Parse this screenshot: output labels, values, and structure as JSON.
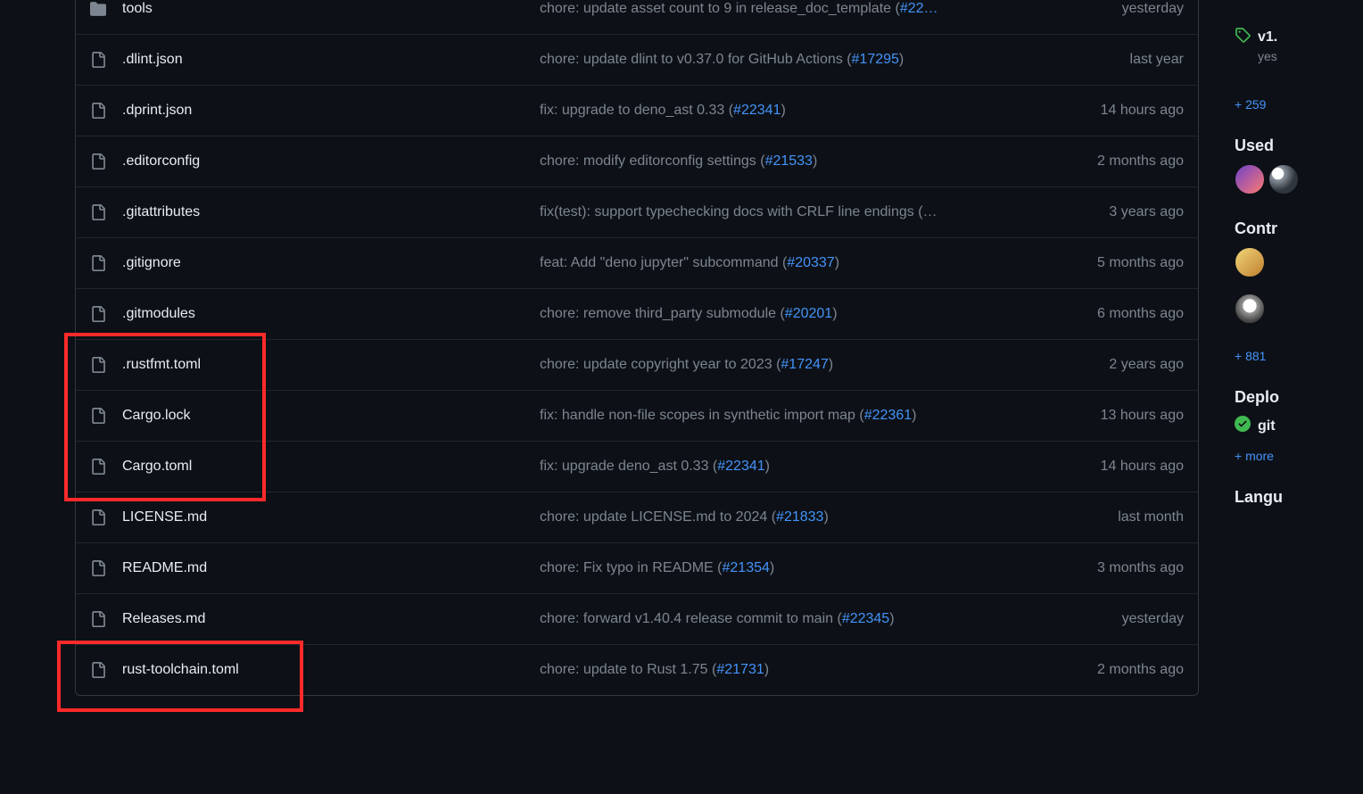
{
  "files": [
    {
      "type": "folder",
      "name": "tools",
      "commit_msg": "chore: update asset count to 9 in release_doc_template (",
      "issue": "#22…",
      "suffix": "",
      "age": "yesterday"
    },
    {
      "type": "file",
      "name": ".dlint.json",
      "commit_msg": "chore: update dlint to v0.37.0 for GitHub Actions (",
      "issue": "#17295",
      "suffix": ")",
      "age": "last year"
    },
    {
      "type": "file",
      "name": ".dprint.json",
      "commit_msg": "fix: upgrade to deno_ast 0.33 (",
      "issue": "#22341",
      "suffix": ")",
      "age": "14 hours ago"
    },
    {
      "type": "file",
      "name": ".editorconfig",
      "commit_msg": "chore: modify editorconfig settings (",
      "issue": "#21533",
      "suffix": ")",
      "age": "2 months ago"
    },
    {
      "type": "file",
      "name": ".gitattributes",
      "commit_msg": "fix(test): support typechecking docs with CRLF line endings (…",
      "issue": "",
      "suffix": "",
      "age": "3 years ago"
    },
    {
      "type": "file",
      "name": ".gitignore",
      "commit_msg": "feat: Add \"deno jupyter\" subcommand (",
      "issue": "#20337",
      "suffix": ")",
      "age": "5 months ago"
    },
    {
      "type": "file",
      "name": ".gitmodules",
      "commit_msg": "chore: remove third_party submodule (",
      "issue": "#20201",
      "suffix": ")",
      "age": "6 months ago"
    },
    {
      "type": "file",
      "name": ".rustfmt.toml",
      "commit_msg": "chore: update copyright year to 2023 (",
      "issue": "#17247",
      "suffix": ")",
      "age": "2 years ago"
    },
    {
      "type": "file",
      "name": "Cargo.lock",
      "commit_msg": "fix: handle non-file scopes in synthetic import map (",
      "issue": "#22361",
      "suffix": ")",
      "age": "13 hours ago"
    },
    {
      "type": "file",
      "name": "Cargo.toml",
      "commit_msg": "fix: upgrade deno_ast 0.33 (",
      "issue": "#22341",
      "suffix": ")",
      "age": "14 hours ago"
    },
    {
      "type": "file",
      "name": "LICENSE.md",
      "commit_msg": "chore: update LICENSE.md to 2024 (",
      "issue": "#21833",
      "suffix": ")",
      "age": "last month"
    },
    {
      "type": "file",
      "name": "README.md",
      "commit_msg": "chore: Fix typo in README (",
      "issue": "#21354",
      "suffix": ")",
      "age": "3 months ago"
    },
    {
      "type": "file",
      "name": "Releases.md",
      "commit_msg": "chore: forward v1.40.4 release commit to main (",
      "issue": "#22345",
      "suffix": ")",
      "age": "yesterday"
    },
    {
      "type": "file",
      "name": "rust-toolchain.toml",
      "commit_msg": "chore: update to Rust 1.75 (",
      "issue": "#21731",
      "suffix": ")",
      "age": "2 months ago"
    }
  ],
  "sidebar": {
    "release_tag": "v1.",
    "release_sub": "yes",
    "releases_more": "+ 259",
    "used_by_label": "Used ",
    "contributors_label": "Contr",
    "contributors_more": "+ 881",
    "deployments_label": "Deplo",
    "deployment_env": "git",
    "deployments_more": "+ more",
    "languages_label": "Langu"
  }
}
